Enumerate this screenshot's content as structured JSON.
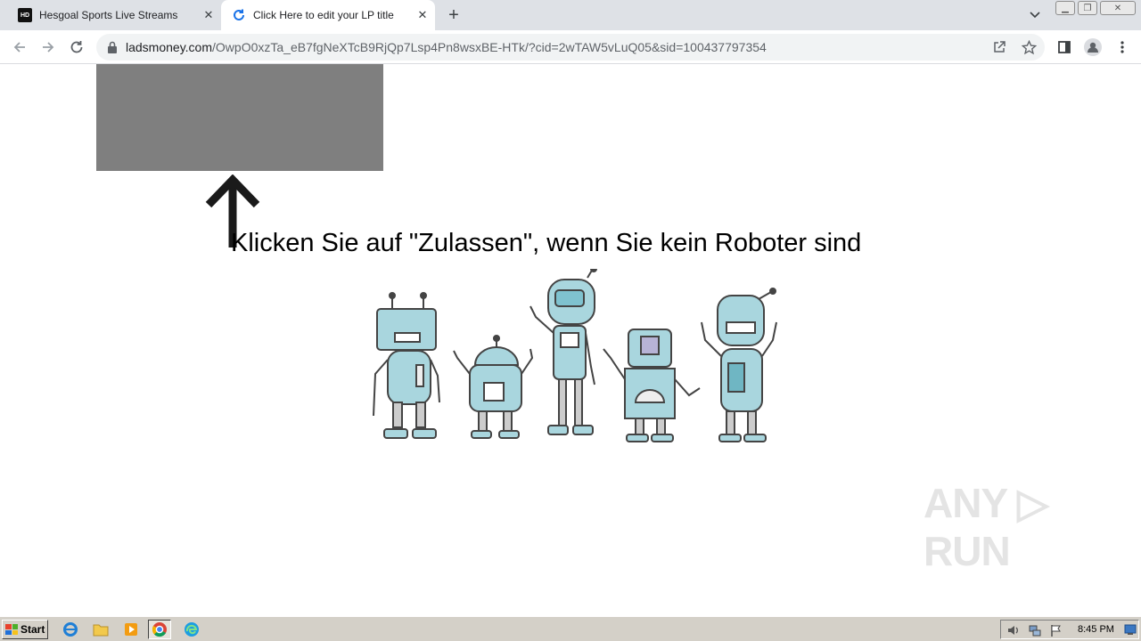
{
  "tabs": [
    {
      "title": "Hesgoal Sports Live Streams",
      "favicon": "HD",
      "active": false
    },
    {
      "title": "Click Here to edit your LP title",
      "favicon": "loading-icon",
      "active": true
    }
  ],
  "toolbar": {
    "url_host": "ladsmoney.com",
    "url_path": "/OwpO0xzTa_eB7fgNeXTcB9RjQp7Lsp4Pn8wsxBE-HTk/?cid=2wTAW5vLuQ05&sid=100437797354"
  },
  "page": {
    "headline": "Klicken Sie auf \"Zulassen\", wenn Sie kein Roboter sind",
    "box_color": "#7f7f7f"
  },
  "watermark": "ANY ▷ RUN",
  "taskbar": {
    "start_label": "Start",
    "clock": "8:45 PM"
  }
}
